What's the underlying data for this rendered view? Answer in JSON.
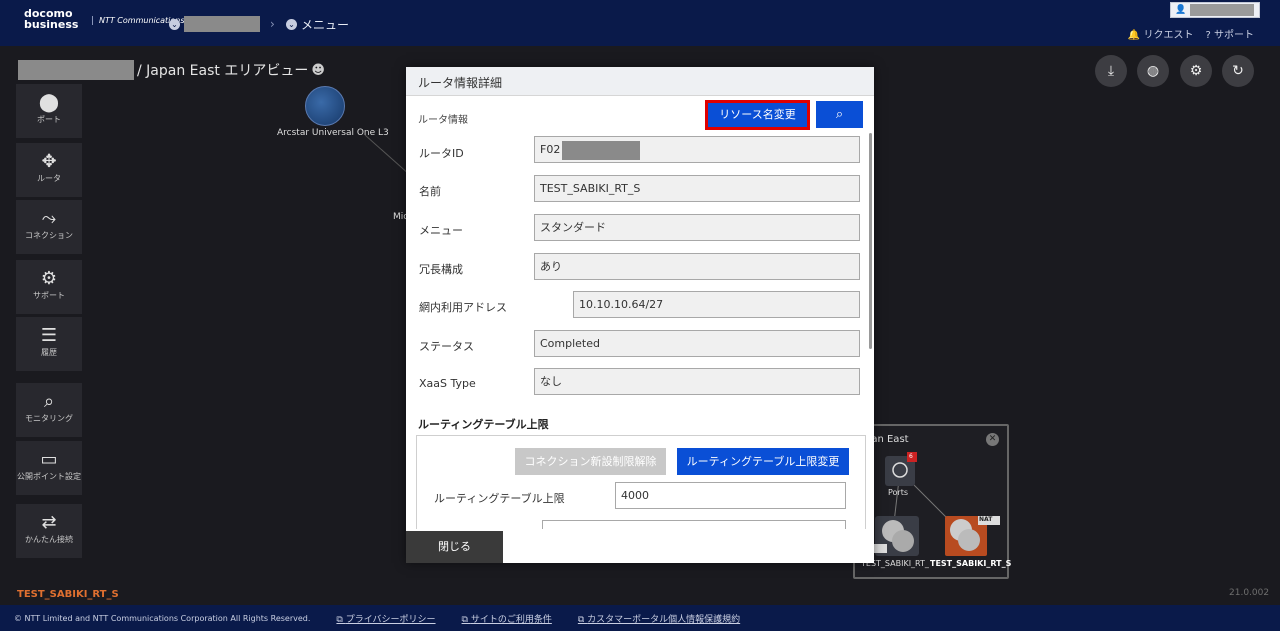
{
  "header": {
    "logo_line1": "docomo",
    "logo_line2": "business",
    "ntt_logo": "NTT Communications",
    "breadcrumb_menu": "メニュー",
    "request_link": "リクエスト",
    "support_link": "サポート"
  },
  "page": {
    "title": "/ Japan East エリアビュー"
  },
  "tools": {
    "download_icon": "download-icon",
    "globe_icon": "globe-icon",
    "settings_icon": "gear-icon",
    "refresh_icon": "refresh-icon"
  },
  "sidebar": {
    "items": [
      {
        "label": "ポート",
        "icon": "⬤"
      },
      {
        "label": "ルータ",
        "icon": "✥"
      },
      {
        "label": "コネクション",
        "icon": "⤳"
      },
      {
        "label": "サポート",
        "icon": "⚙"
      },
      {
        "label": "履歴",
        "icon": "☰"
      },
      {
        "label": "モニタリング",
        "icon": "⌕"
      },
      {
        "label": "公開ポイント設定",
        "icon": "▭"
      },
      {
        "label": "かんたん接続",
        "icon": "⇄"
      }
    ]
  },
  "canvas": {
    "node1_label": "Arcstar Universal One L3",
    "node2_label": "Mic",
    "selected_router": "TEST_SABIKI_RT_S",
    "version": "21.0.002"
  },
  "minimap": {
    "title": "pan East",
    "ports_label": "Ports",
    "ports_badge": "6",
    "router1_label": "TEST_SABIKI_RT_",
    "router2_label": "TEST_SABIKI_RT_S",
    "nat_badge": "NAT"
  },
  "modal": {
    "title": "ルータ情報詳細",
    "section_label": "ルータ情報",
    "rename_button": "リソース名変更",
    "fields": [
      {
        "label": "ルータID",
        "value": "F02"
      },
      {
        "label": "名前",
        "value": "TEST_SABIKI_RT_S"
      },
      {
        "label": "メニュー",
        "value": "スタンダード"
      },
      {
        "label": "冗長構成",
        "value": "あり"
      },
      {
        "label": "網内利用アドレス",
        "value": "10.10.10.64/27"
      },
      {
        "label": "ステータス",
        "value": "Completed"
      },
      {
        "label": "XaaS Type",
        "value": "なし"
      }
    ],
    "routing_section_title": "ルーティングテーブル上限",
    "release_limit_button": "コネクション新設制限解除",
    "change_limit_button": "ルーティングテーブル上限変更",
    "routing_limit_label": "ルーティングテーブル上限",
    "routing_limit_value": "4000",
    "close_button": "閉じる"
  },
  "footer": {
    "copyright": "© NTT Limited and NTT Communications Corporation All Rights Reserved.",
    "privacy_link": "プライバシーポリシー",
    "terms_link": "サイトのご利用条件",
    "customer_privacy_link": "カスタマーポータル個人情報保護規約"
  }
}
